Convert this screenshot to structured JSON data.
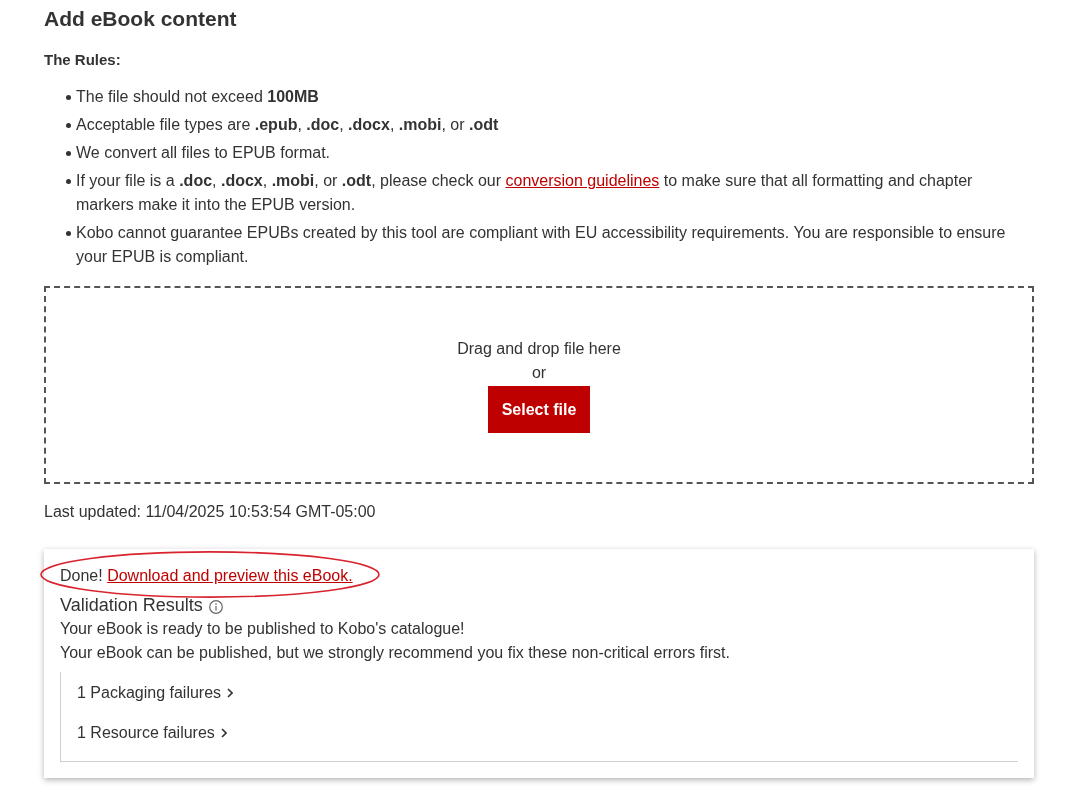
{
  "page": {
    "title": "Add eBook content"
  },
  "rules": {
    "heading": "The Rules:",
    "items": [
      {
        "parts": [
          {
            "kind": "text",
            "text": "The file should not exceed **100MB**"
          }
        ]
      },
      {
        "parts": [
          {
            "kind": "text",
            "text": "Acceptable file types are **.epub**, **.doc**, **.docx**, **.mobi**, or **.odt**"
          }
        ]
      },
      {
        "parts": [
          {
            "kind": "text",
            "text": "We convert all files to EPUB format."
          }
        ]
      },
      {
        "parts": [
          {
            "kind": "text",
            "text": "If your file is a **.doc**, **.docx**, **.mobi**, or **.odt**, please check our "
          },
          {
            "kind": "link",
            "text": "conversion guidelines"
          },
          {
            "kind": "text",
            "text": " to make sure that all formatting and chapter markers make it into the EPUB version."
          }
        ]
      },
      {
        "parts": [
          {
            "kind": "text",
            "text": "Kobo cannot guarantee EPUBs created by this tool are compliant with EU accessibility requirements. You are responsible to ensure your EPUB is compliant."
          }
        ]
      }
    ]
  },
  "dropzone": {
    "prompt": "Drag and drop file here",
    "separator": "or",
    "button": "Select file"
  },
  "last_updated": "Last updated: 11/04/2025 10:53:54 GMT-05:00",
  "result": {
    "done": "Done!",
    "link": "Download and preview this eBook.",
    "heading": "Validation Results",
    "messages": [
      "Your eBook is ready to be published to Kobo's catalogue!",
      "Your eBook can be published, but we strongly recommend you fix these non-critical errors first."
    ],
    "failures": [
      {
        "label": "1 Packaging failures",
        "expanded": false
      },
      {
        "label": "1 Resource failures",
        "expanded": false
      }
    ],
    "annotations": [
      {
        "kind": "ellipse"
      }
    ]
  }
}
